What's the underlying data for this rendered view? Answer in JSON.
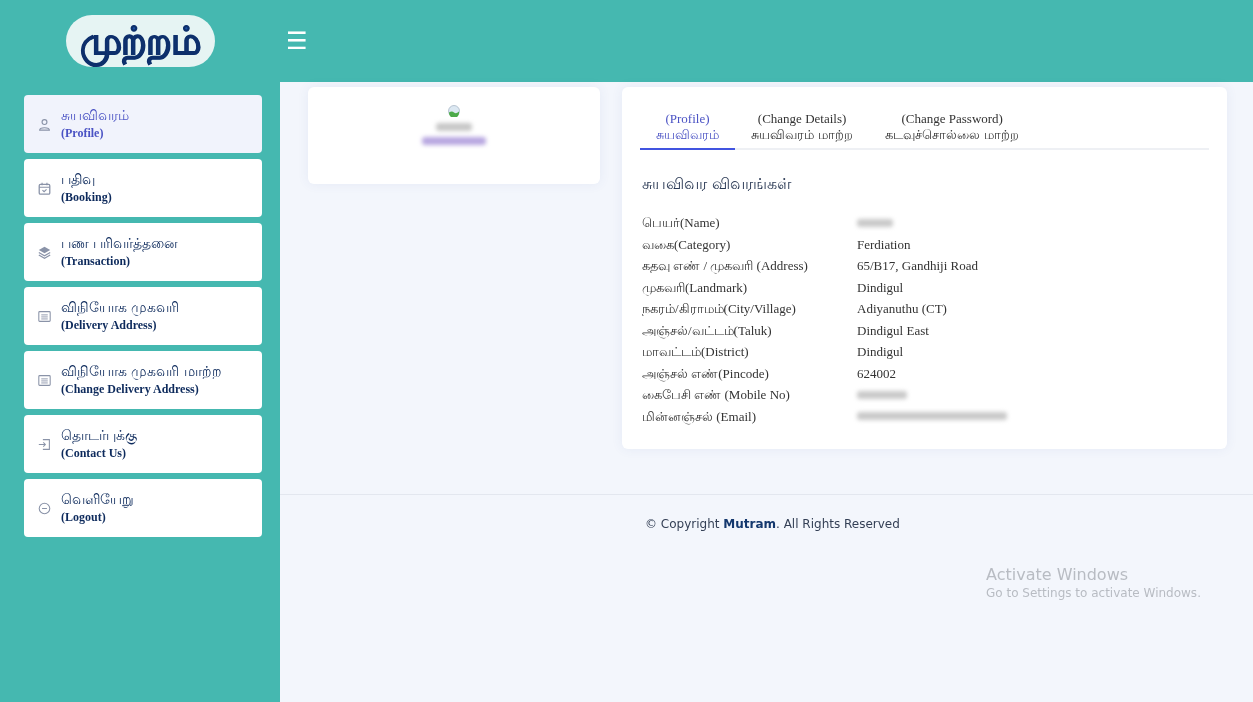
{
  "header": {
    "logo_text": "முற்றம்",
    "menu_glyph": "☰"
  },
  "sidebar": {
    "items": [
      {
        "tamil": "சுயவிவரம்",
        "english": "(Profile)",
        "kind": "person",
        "selected": true
      },
      {
        "tamil": "பதிவு",
        "english": "(Booking)",
        "kind": "calendar",
        "selected": false
      },
      {
        "tamil": "பண பரிவர்த்தனை",
        "english": "(Transaction)",
        "kind": "layers",
        "selected": false
      },
      {
        "tamil": "விநியோக முகவரி",
        "english": "(Delivery Address)",
        "kind": "list",
        "selected": false
      },
      {
        "tamil": "விநியோக முகவரி மாற்ற",
        "english": "(Change Delivery Address)",
        "kind": "list",
        "selected": false
      },
      {
        "tamil": "தொடர்புக்கு",
        "english": "(Contact Us)",
        "kind": "enter",
        "selected": false
      },
      {
        "tamil": "வெளியேறு",
        "english": "(Logout)",
        "kind": "minus",
        "selected": false
      }
    ]
  },
  "profile_card": {
    "name_redacted": true,
    "phone_redacted": true
  },
  "details": {
    "tabs": [
      {
        "english": "(Profile)",
        "tamil": "சுயவிவரம்",
        "selected": true
      },
      {
        "english": "(Change Details)",
        "tamil": "சுயவிவரம் மாற்ற",
        "selected": false
      },
      {
        "english": "(Change Password)",
        "tamil": "கடவுச்சொல்லை மாற்ற",
        "selected": false
      }
    ],
    "heading": "சுயவிவர விவரங்கள்",
    "rows": [
      {
        "label": "பெயர்(Name)",
        "kind": "redacted"
      },
      {
        "label": "வகை(Category)",
        "kind": "text",
        "value": "Ferdiation"
      },
      {
        "label": "கதவு எண் / முகவரி (Address)",
        "kind": "text",
        "value": "65/B17, Gandhiji Road"
      },
      {
        "label": "முகவரி(Landmark)",
        "kind": "text",
        "value": "Dindigul"
      },
      {
        "label": "நகரம்/கிராமம்(City/Village)",
        "kind": "text",
        "value": "Adiyanuthu (CT)"
      },
      {
        "label": "அஞ்சல்/வட்டம்(Taluk)",
        "kind": "text",
        "value": "Dindigul East"
      },
      {
        "label": "மாவட்டம்(District)",
        "kind": "text",
        "value": "Dindigul"
      },
      {
        "label": "அஞ்சல் எண்(Pincode)",
        "kind": "text",
        "value": "624002"
      },
      {
        "label": "கைபேசி எண் (Mobile No)",
        "kind": "redacted"
      },
      {
        "label": "மின்னஞ்சல் (Email)",
        "kind": "redacted"
      }
    ]
  },
  "footer": {
    "copyright": "© Copyright **Mutram**. All Rights Reserved"
  },
  "os_notice": {
    "title": "Activate Windows",
    "subtitle": "Go to Settings to activate Windows."
  }
}
